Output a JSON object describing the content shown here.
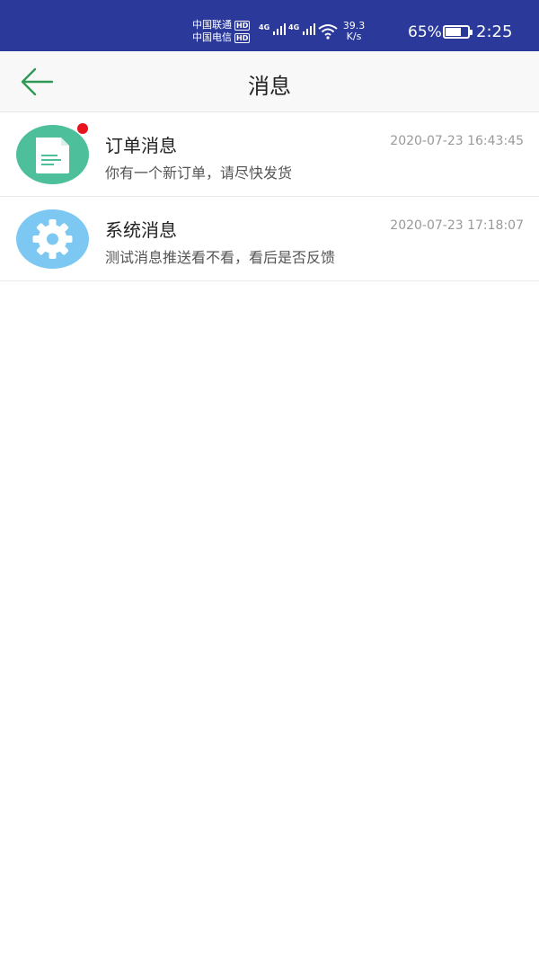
{
  "status_bar": {
    "carrier_1": "中国联通",
    "carrier_2": "中国电信",
    "hd_badge": "HD",
    "network_1": "4G",
    "network_2": "4G",
    "speed_value": "39.3",
    "speed_unit": "K/s",
    "battery_percent": "65%",
    "battery_level": 0.65,
    "time": "2:25"
  },
  "nav": {
    "title": "消息",
    "back_icon": "arrow-left-icon"
  },
  "colors": {
    "status_bar_bg": "#2b3a9a",
    "back_arrow": "#2f9a57",
    "order_icon_bg": "#4dbf9a",
    "system_icon_bg": "#7cc8f2",
    "unread_dot": "#e8141d"
  },
  "messages": [
    {
      "icon": "document-icon",
      "title": "订单消息",
      "time": "2020-07-23 16:43:45",
      "desc": "你有一个新订单，请尽快发货",
      "unread": true
    },
    {
      "icon": "gear-icon",
      "title": "系统消息",
      "time": "2020-07-23 17:18:07",
      "desc": "测试消息推送看不看，看后是否反馈",
      "unread": false
    }
  ]
}
